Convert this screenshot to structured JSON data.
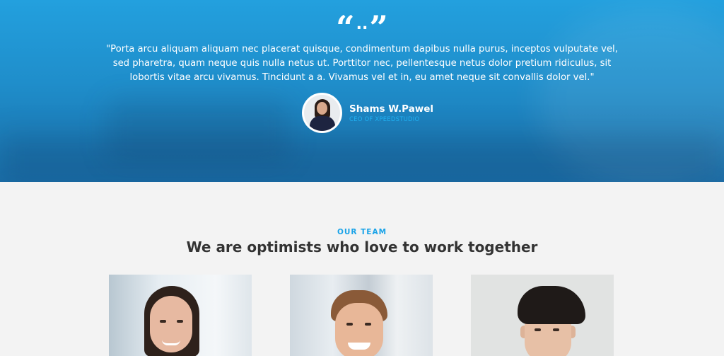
{
  "testimonial": {
    "quote_open": "“",
    "quote_dots": "..",
    "quote_close": "”",
    "text": "\"Porta arcu aliquam aliquam nec placerat quisque, condimentum dapibus nulla purus, inceptos vulputate vel, sed pharetra, quam neque quis nulla netus ut. Porttitor nec, pellentesque netus dolor pretium ridiculus, sit lobortis vitae arcu vivamus. Tincidunt a a. Vivamus vel et in, eu amet neque sit convallis dolor vel.\"",
    "author_name": "Shams W.Pawel",
    "author_role": "CEO OF XPEEDSTUDIO"
  },
  "team": {
    "kicker": "OUR TEAM",
    "title": "We are optimists who love to work together",
    "members": [
      {
        "photo": "team-member-woman-photo"
      },
      {
        "photo": "team-member-man-photo"
      },
      {
        "photo": "team-member-young-man-photo"
      }
    ]
  },
  "colors": {
    "hero_top": "#23a0de",
    "hero_bottom": "#1a6ea8",
    "accent": "#1aa3e8",
    "page_bg": "#f3f3f3",
    "title_text": "#333333"
  }
}
